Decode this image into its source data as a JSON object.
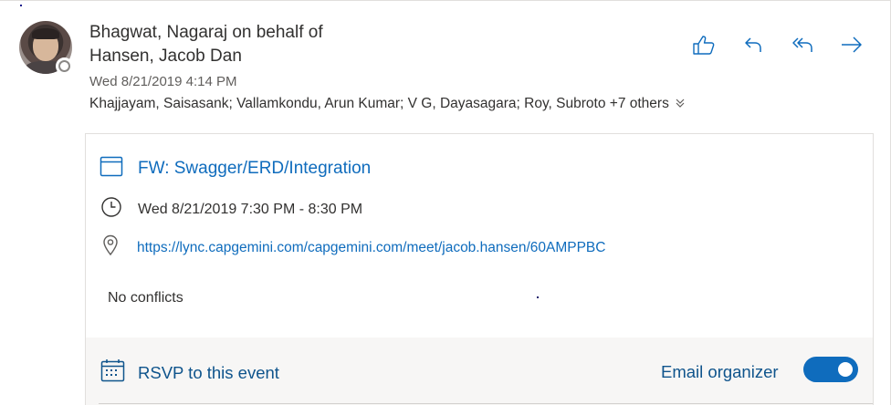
{
  "message": {
    "sender_line1": "Bhagwat, Nagaraj on behalf of",
    "sender_line2": "Hansen, Jacob Dan",
    "date": "Wed 8/21/2019 4:14 PM",
    "recipients": "Khajjayam, Saisasank; Vallamkondu, Arun Kumar; V G, Dayasagara; Roy, Subroto +7 others",
    "expand_icon": "chevron-double-down-icon"
  },
  "actions": [
    {
      "name": "like",
      "icon": "thumbs-up-icon"
    },
    {
      "name": "reply",
      "icon": "reply-icon"
    },
    {
      "name": "reply-all",
      "icon": "reply-all-icon"
    },
    {
      "name": "forward",
      "icon": "forward-arrow-icon"
    }
  ],
  "event": {
    "title": "FW: Swagger/ERD/Integration",
    "time": "Wed 8/21/2019 7:30 PM - 8:30 PM",
    "location_url": "https://lync.capgemini.com/capgemini.com/meet/jacob.hansen/60AMPPBC",
    "conflicts": "No conflicts"
  },
  "footer": {
    "rsvp_label": "RSVP to this event",
    "email_organizer_label": "Email organizer",
    "email_organizer_enabled": true
  },
  "colors": {
    "accent": "#0f6cbd",
    "footer_text": "#0f548c",
    "footer_bg": "#f7f6f5"
  }
}
